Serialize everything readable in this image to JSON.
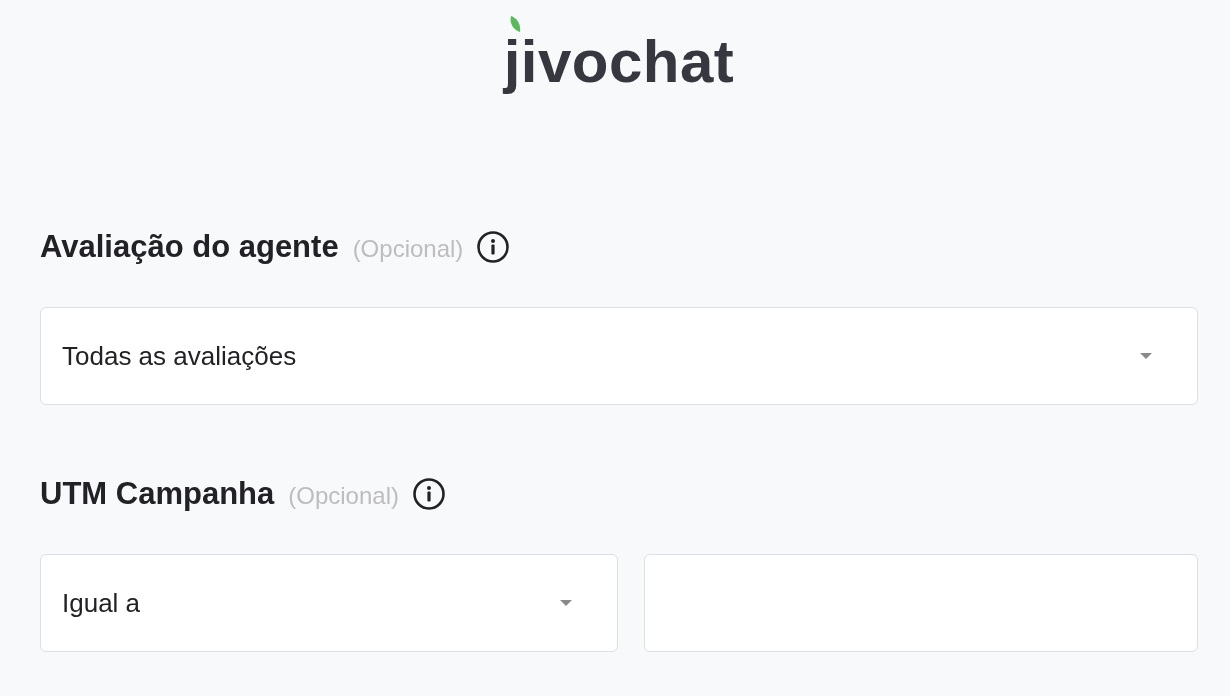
{
  "logo": {
    "text": "jivochat"
  },
  "sections": [
    {
      "title": "Avaliação do agente",
      "optional": "(Opcional)",
      "fields": [
        {
          "kind": "select",
          "value": "Todas as avaliações"
        }
      ]
    },
    {
      "title": "UTM Campanha",
      "optional": "(Opcional)",
      "fields": [
        {
          "kind": "select",
          "value": "Igual a"
        },
        {
          "kind": "input"
        }
      ]
    }
  ]
}
